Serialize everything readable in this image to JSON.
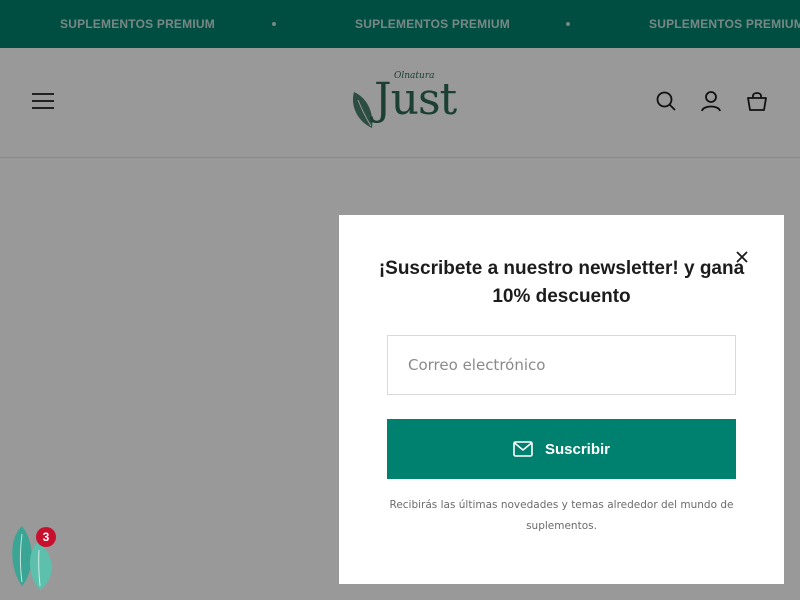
{
  "announcement": {
    "items": [
      "SUPLEMENTOS PREMIUM",
      "SUPLEMENTOS PREMIUM",
      "SUPLEMENTOS PREMIUM"
    ]
  },
  "header": {
    "logo_brand": "Olnatura",
    "logo_word": "Just",
    "icons": [
      "menu-icon",
      "search-icon",
      "account-icon",
      "cart-icon"
    ]
  },
  "newsletter": {
    "title": "¡Suscribete a nuestro newsletter! y gana 10% descuento",
    "email_placeholder": "Correo electrónico",
    "email_value": "",
    "subscribe_label": "Suscribir",
    "note": "Recibirás las últimas novedades y temas alrededor del mundo de suplementos."
  },
  "widget": {
    "badge_count": "3"
  },
  "colors": {
    "brand_green": "#00806f",
    "logo_green": "#2e6a55",
    "badge_red": "#c8102e"
  }
}
